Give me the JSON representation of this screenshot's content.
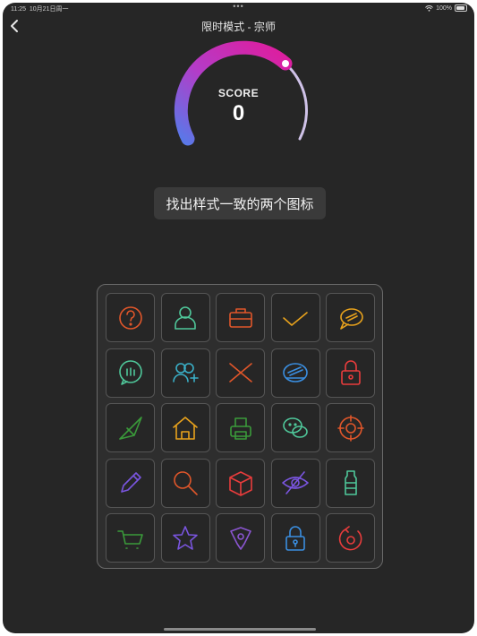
{
  "status": {
    "time": "11:25",
    "date": "10月21日周一",
    "dots": "•••",
    "battery_text": "100%"
  },
  "header": {
    "title": "限时模式 - 宗师"
  },
  "score": {
    "label": "SCORE",
    "value": "0"
  },
  "hint": "找出样式一致的两个图标",
  "tiles": [
    {
      "icon": "question-icon",
      "color": "#e0562a"
    },
    {
      "icon": "user-icon",
      "color": "#4fc79a"
    },
    {
      "icon": "briefcase-icon",
      "color": "#e0562a"
    },
    {
      "icon": "checkmark-icon",
      "color": "#e8a21c"
    },
    {
      "icon": "chat-bubble-icon",
      "color": "#e8a21c"
    },
    {
      "icon": "info-chat-icon",
      "color": "#4fc79a"
    },
    {
      "icon": "add-user-icon",
      "color": "#3ab0c8"
    },
    {
      "icon": "close-icon",
      "color": "#e0562a"
    },
    {
      "icon": "stamp-icon",
      "color": "#3a8ee0"
    },
    {
      "icon": "padlock-icon",
      "color": "#e83c3c"
    },
    {
      "icon": "paper-plane-icon",
      "color": "#3a9a3a"
    },
    {
      "icon": "house-icon",
      "color": "#e8a21c"
    },
    {
      "icon": "printer-icon",
      "color": "#3a9a3a"
    },
    {
      "icon": "wechat-icon",
      "color": "#4fc79a"
    },
    {
      "icon": "target-icon",
      "color": "#e0562a"
    },
    {
      "icon": "pencil-icon",
      "color": "#7a55e0"
    },
    {
      "icon": "magnifier-icon",
      "color": "#e0562a"
    },
    {
      "icon": "package-icon",
      "color": "#e83c3c"
    },
    {
      "icon": "eye-slash-icon",
      "color": "#7a55e0"
    },
    {
      "icon": "bottle-icon",
      "color": "#4fc79a"
    },
    {
      "icon": "cart-icon",
      "color": "#3a9a3a"
    },
    {
      "icon": "star-icon",
      "color": "#7a55e0"
    },
    {
      "icon": "location-pin-icon",
      "color": "#8a55d0"
    },
    {
      "icon": "padlock-open-icon",
      "color": "#3a8ee0"
    },
    {
      "icon": "gear-refresh-icon",
      "color": "#e83c3c"
    }
  ]
}
